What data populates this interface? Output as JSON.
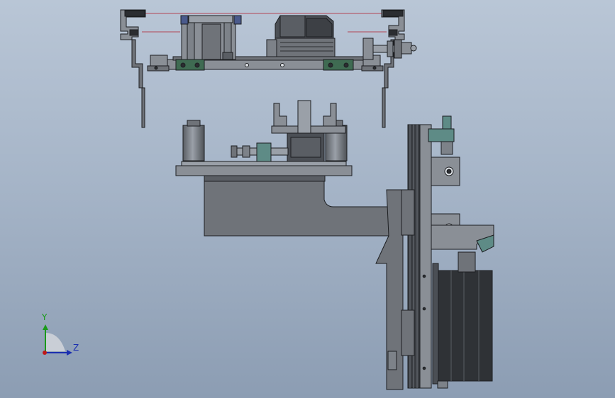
{
  "viewport": {
    "background_top": "#b9c6d6",
    "background_bottom": "#8c9db3"
  },
  "model": {
    "steel_light": "#8a8f96",
    "steel_mid": "#6f7379",
    "steel_dark": "#4b4f55",
    "edge": "#1c1e21",
    "accent_green": "#3f6b52",
    "accent_teal": "#5e8b86",
    "accent_blue": "#4a5a8c",
    "sensor_wire": "#b01a2a"
  },
  "triad": {
    "y_label": "Y",
    "z_label": "Z",
    "y_color": "#1a9a1a",
    "z_color": "#1b2fb0",
    "origin_color": "#c01818"
  }
}
